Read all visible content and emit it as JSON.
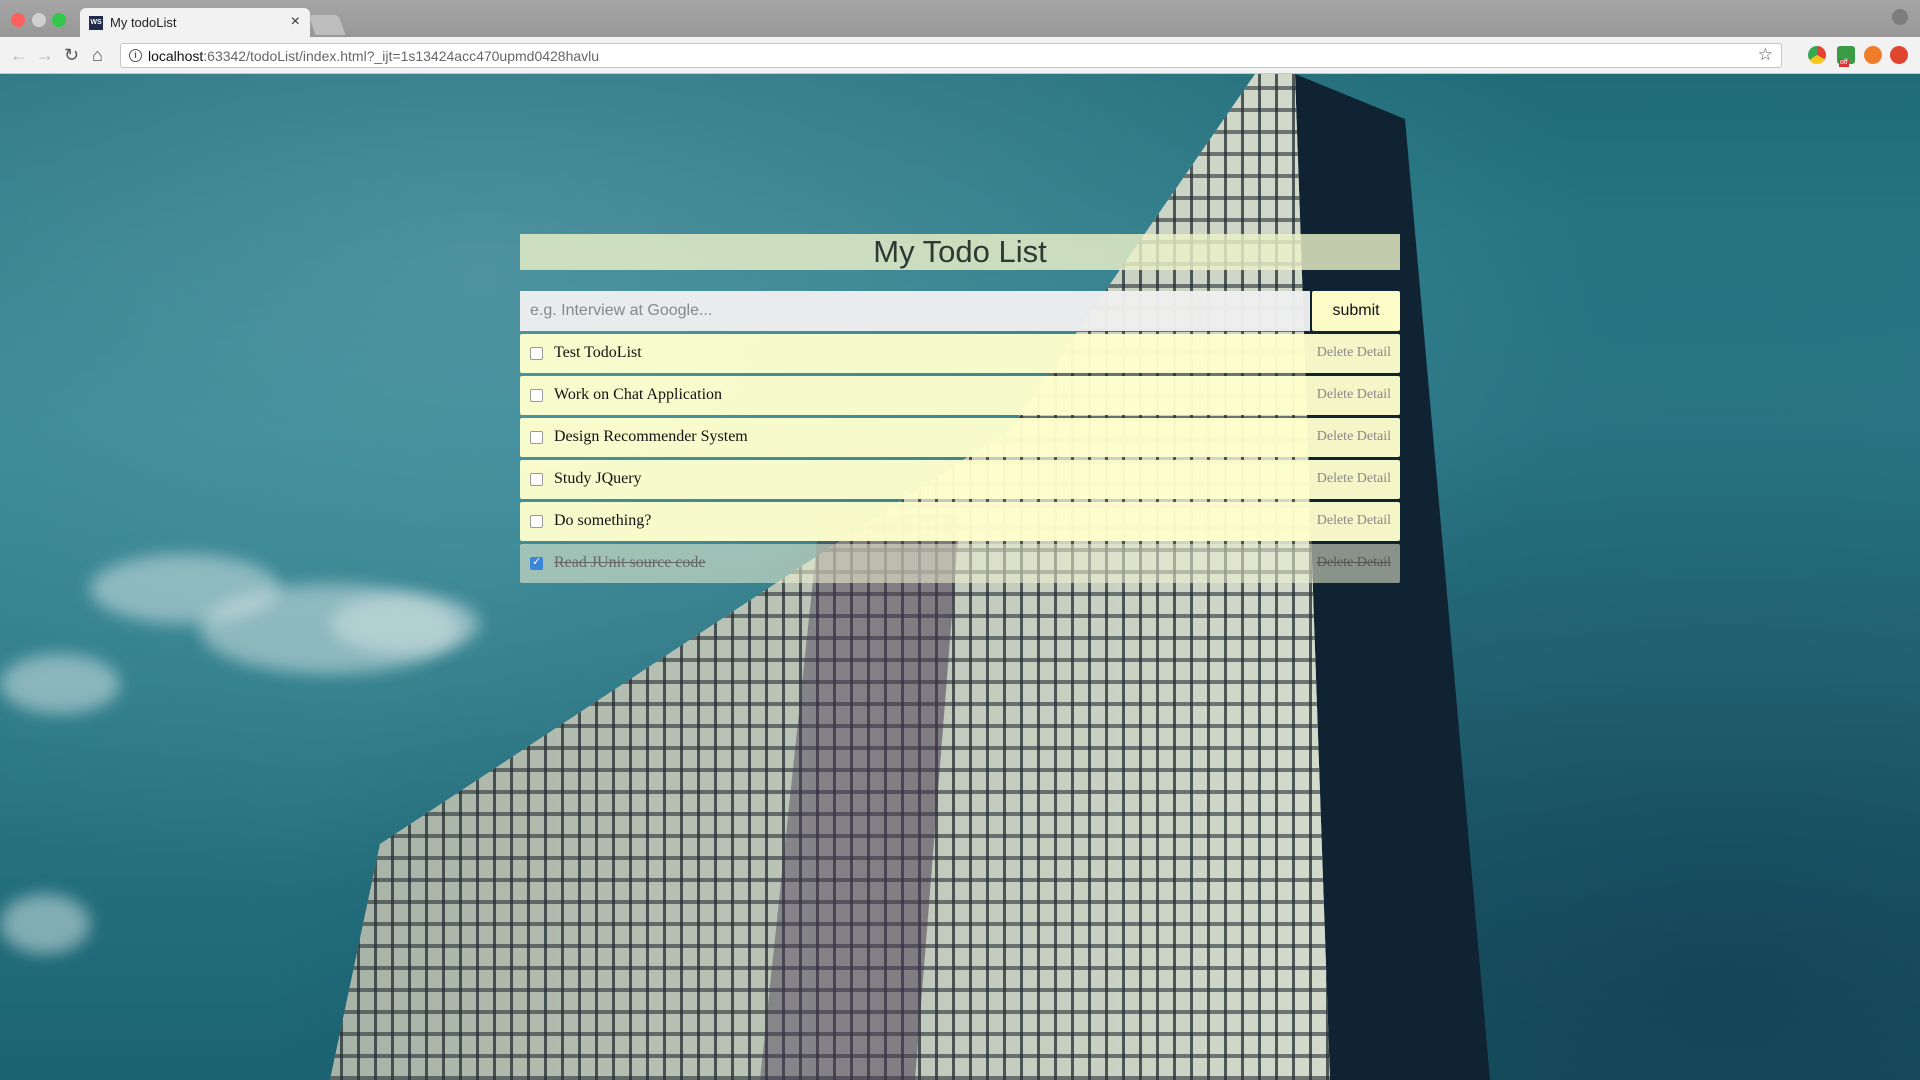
{
  "browser": {
    "tab_title": "My todoList",
    "tab_favicon_text": "WS",
    "url_host": "localhost",
    "url_rest": ":63342/todoList/index.html?_ijt=1s13424acc470upmd0428havlu"
  },
  "app": {
    "title": "My Todo List",
    "input_placeholder": "e.g. Interview at Google...",
    "input_value": "",
    "submit_label": "submit",
    "delete_label": "Delete",
    "detail_label": "Detail",
    "items": [
      {
        "text": "Test TodoList",
        "done": false
      },
      {
        "text": "Work on Chat Application",
        "done": false
      },
      {
        "text": "Design Recommender System",
        "done": false
      },
      {
        "text": "Study JQuery",
        "done": false
      },
      {
        "text": "Do something?",
        "done": false
      },
      {
        "text": "Read JUnit source code",
        "done": true
      }
    ]
  }
}
